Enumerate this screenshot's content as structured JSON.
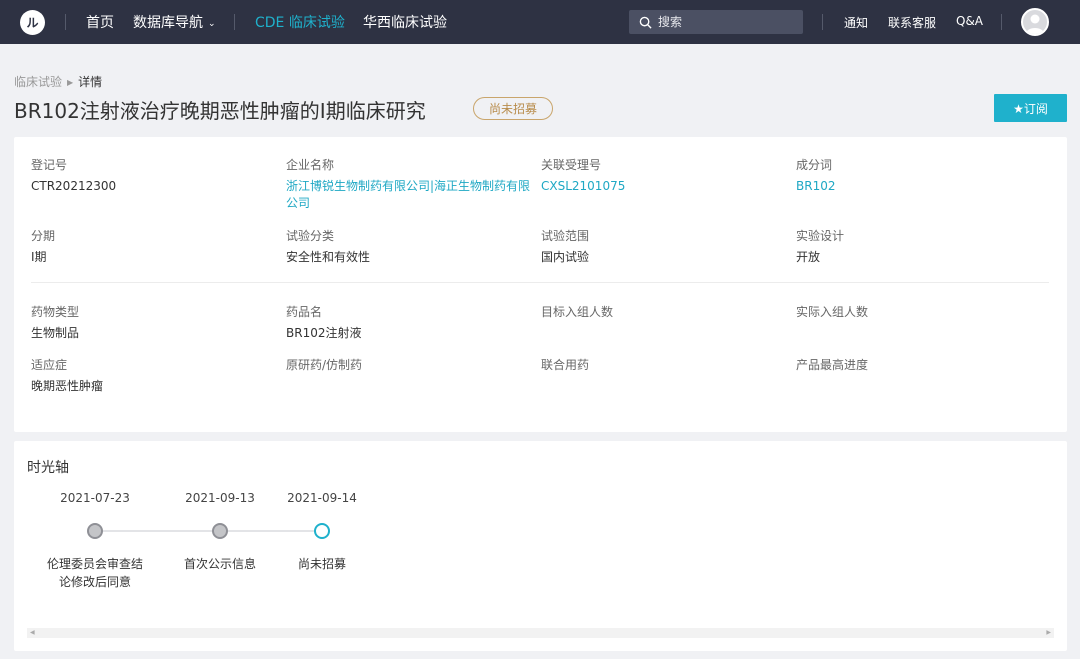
{
  "nav": {
    "logo_text": "ル",
    "items": [
      {
        "label": "首页"
      },
      {
        "label": "数据库导航"
      },
      {
        "label": "CDE 临床试验"
      },
      {
        "label": "华西临床试验"
      }
    ],
    "search_placeholder": "搜索",
    "right": [
      {
        "label": "通知"
      },
      {
        "label": "联系客服"
      },
      {
        "label": "Q&A"
      }
    ],
    "active_color": "#1fb1cc",
    "bg_color": "#2e3243"
  },
  "breadcrumb": {
    "parent": "临床试验",
    "current": "详情"
  },
  "title": "BR102注射液治疗晚期恶性肿瘤的I期临床研究",
  "status": "尚未招募",
  "subscribe_label": "★订阅",
  "info": {
    "reg_no": {
      "label": "登记号",
      "value": "CTR20212300"
    },
    "company": {
      "label": "企业名称",
      "value": "浙江博锐生物制药有限公司|海正生物制药有限公司"
    },
    "accept_no": {
      "label": "关联受理号",
      "value": "CXSL2101075"
    },
    "ingredient": {
      "label": "成分词",
      "value": "BR102"
    },
    "phase": {
      "label": "分期",
      "value": "I期"
    },
    "category": {
      "label": "试验分类",
      "value": "安全性和有效性"
    },
    "scope": {
      "label": "试验范围",
      "value": "国内试验"
    },
    "design": {
      "label": "实验设计",
      "value": "开放"
    },
    "drug_type": {
      "label": "药物类型",
      "value": "生物制品"
    },
    "drug_name": {
      "label": "药品名",
      "value": "BR102注射液"
    },
    "target_n": {
      "label": "目标入组人数",
      "value": ""
    },
    "actual_n": {
      "label": "实际入组人数",
      "value": ""
    },
    "indication": {
      "label": "适应症",
      "value": "晚期恶性肿瘤"
    },
    "original": {
      "label": "原研药/仿制药",
      "value": ""
    },
    "combo": {
      "label": "联合用药",
      "value": ""
    },
    "progress": {
      "label": "产品最高进度",
      "value": ""
    }
  },
  "timeline": {
    "title": "时光轴",
    "events": [
      {
        "date": "2021-07-23",
        "label": "伦理委员会审查结论修改后同意"
      },
      {
        "date": "2021-09-13",
        "label": "首次公示信息"
      },
      {
        "date": "2021-09-14",
        "label": "尚未招募"
      }
    ]
  }
}
